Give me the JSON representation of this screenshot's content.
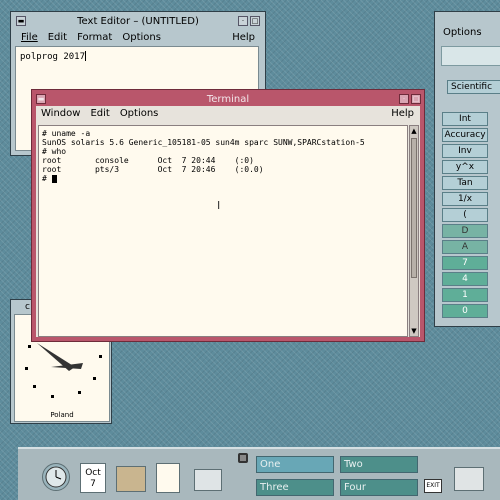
{
  "text_editor": {
    "title": "Text Editor – (UNTITLED)",
    "menu": {
      "file": "File",
      "edit": "Edit",
      "format": "Format",
      "options": "Options",
      "help": "Help"
    },
    "content": "polprog 2017"
  },
  "terminal": {
    "title": "Terminal",
    "menu": {
      "window": "Window",
      "edit": "Edit",
      "options": "Options",
      "help": "Help"
    },
    "lines": [
      "# uname -a",
      "SunOS solaris 5.6 Generic_105181-05 sun4m sparc SUNW,SPARCstation-5",
      "# who",
      "root       console      Oct  7 20:44    (:0)",
      "root       pts/3        Oct  7 20:46    (:0.0)",
      "# "
    ]
  },
  "calculator": {
    "options_label": "Options",
    "mode": "Scientific",
    "buttons": [
      "Int",
      "Accuracy",
      "Inv",
      "y^x",
      "Tan",
      "1/x",
      "(",
      "D",
      "A",
      "7",
      "4",
      "1",
      "0"
    ]
  },
  "clock": {
    "title": "c",
    "location": "Poland"
  },
  "front_panel": {
    "date_month": "Oct",
    "date_day": "7",
    "workspaces": [
      "One",
      "Two",
      "Three",
      "Four"
    ],
    "exit_label": "EXIT"
  },
  "colors": {
    "desktop": "#5e8c9c",
    "editor_frame": "#b7c7cd",
    "terminal_frame": "#b9566b",
    "terminal_bg": "#fffaee",
    "panel": "#a9b8bd",
    "workspace_active": "#68a7b6"
  }
}
